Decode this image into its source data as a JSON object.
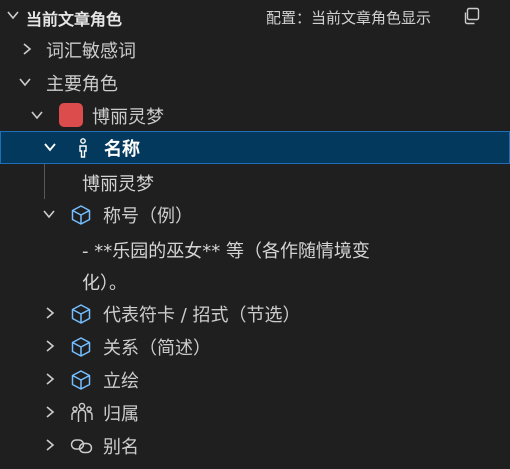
{
  "header": {
    "title": "当前文章角色",
    "config_label": "配置：当前文章角色显示",
    "collapse_icon": "chevron-down-icon",
    "copy_icon": "copy-icon"
  },
  "tree": {
    "vocab": "词汇敏感词",
    "main_roles": "主要角色",
    "character": "博丽灵梦",
    "character_color": "#dc4c4c",
    "name_label": "名称",
    "name_value": "博丽灵梦",
    "title_label": "称号（例）",
    "title_value_line1": "- **乐园的巫女** 等（各作随情境变",
    "title_value_line2": "化）。",
    "cards_label": "代表符卡 / 招式（节选）",
    "relations_label": "关系（简述）",
    "portrait_label": "立绘",
    "affiliation_label": "归属",
    "alias_label": "别名"
  },
  "colors": {
    "background": "#1f1f1f",
    "selection": "#04395e",
    "selection_border": "#1f6fb8",
    "cube_icon": "#75beff"
  }
}
